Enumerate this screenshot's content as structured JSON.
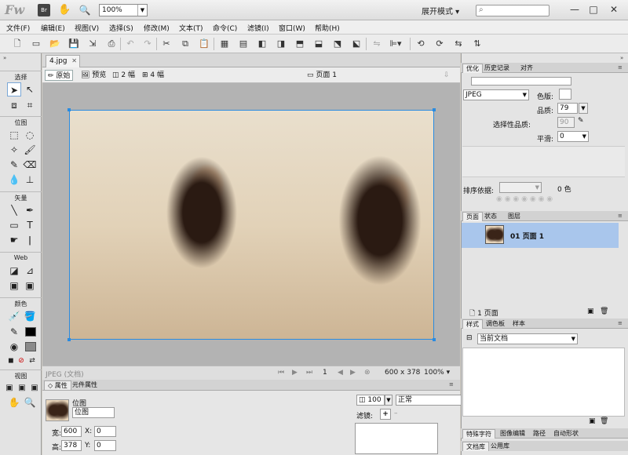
{
  "title_bar": {
    "logo": "Fw",
    "bridge": "Br",
    "zoom": "100%",
    "workspace_mode": "展开模式"
  },
  "menu": [
    "文件(F)",
    "编辑(E)",
    "视图(V)",
    "选择(S)",
    "修改(M)",
    "文本(T)",
    "命令(C)",
    "滤镜(I)",
    "窗口(W)",
    "帮助(H)"
  ],
  "tools_sections": [
    "选择",
    "位图",
    "矢量",
    "Web",
    "颜色",
    "视图"
  ],
  "document": {
    "tab_name": "4.jpg",
    "views": [
      "原始",
      "预览",
      "2 幅",
      "4 幅"
    ],
    "page_selector": "页面 1",
    "status_left": "JPEG (文档)",
    "page_number": "1",
    "size": "600 x 378",
    "zoom": "100%"
  },
  "properties": {
    "tabs": [
      "属性",
      "元件属性"
    ],
    "type_label": "位图",
    "name_value": "位图",
    "width_label": "宽:",
    "width": "600",
    "height_label": "高:",
    "height": "378",
    "x_label": "X:",
    "x": "0",
    "y_label": "Y:",
    "y": "0",
    "opacity": "100",
    "blend_mode": "正常",
    "filters_label": "滤镜:"
  },
  "optimize": {
    "tabs": [
      "优化",
      "历史记录",
      "对齐"
    ],
    "format": "JPEG",
    "matte_label": "色版:",
    "quality_label": "品质:",
    "quality": "79",
    "selective_label": "选择性品质:",
    "selective": "90",
    "smoothing_label": "平滑:",
    "smoothing": "0",
    "sort_label": "排序依据:",
    "colors": "0 色"
  },
  "pages": {
    "tabs": [
      "页面",
      "状态",
      "图层"
    ],
    "item": "01 页面 1",
    "footer": "1 页面"
  },
  "styles": {
    "tabs": [
      "样式",
      "调色板",
      "样本"
    ],
    "current": "当前文档"
  },
  "bottom_tabs_1": [
    "特殊字符",
    "图像编辑",
    "路径",
    "自动形状"
  ],
  "bottom_tabs_2": [
    "文档库",
    "公用库"
  ]
}
